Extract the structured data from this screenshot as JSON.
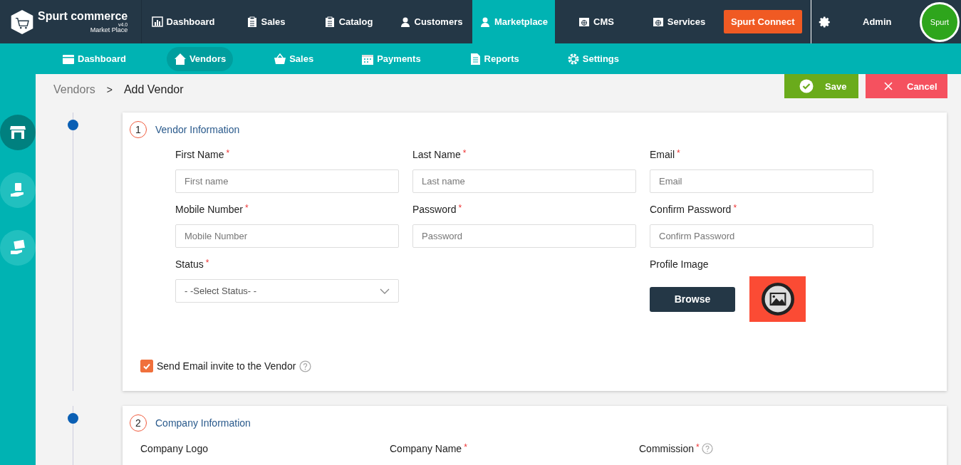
{
  "top_nav": {
    "logo": {
      "name": "Spurt commerce",
      "version": "v4.0",
      "subtitle": "Market Place"
    },
    "items": [
      {
        "label": "Dashboard",
        "selected": false
      },
      {
        "label": "Sales",
        "selected": false
      },
      {
        "label": "Catalog",
        "selected": false
      },
      {
        "label": "Customers",
        "selected": false
      },
      {
        "label": "Marketplace",
        "selected": true
      },
      {
        "label": "CMS",
        "selected": false
      },
      {
        "label": "Services",
        "selected": false
      }
    ],
    "connect_button": "Spurt Connect",
    "user": "Admin",
    "avatar_text": "Spurt"
  },
  "sub_nav": {
    "items": [
      {
        "label": "Dashboard",
        "selected": false
      },
      {
        "label": "Vendors",
        "selected": true
      },
      {
        "label": "Sales",
        "selected": false
      },
      {
        "label": "Payments",
        "selected": false
      },
      {
        "label": "Reports",
        "selected": false
      },
      {
        "label": "Settings",
        "selected": false
      }
    ]
  },
  "side_nav": {
    "items": [
      {
        "selected": true
      },
      {
        "selected": false
      },
      {
        "selected": false
      }
    ]
  },
  "breadcrumb": {
    "parent": "Vendors",
    "separator": ">",
    "current": "Add Vendor"
  },
  "actions": {
    "save": "Save",
    "cancel": "Cancel"
  },
  "sections": [
    {
      "number": "1",
      "title": "Vendor Information",
      "fields": [
        {
          "kind": "text",
          "label": "First Name",
          "required_mark": "*",
          "placeholder": "First name"
        },
        {
          "kind": "text",
          "label": "Last Name",
          "required_mark": "*",
          "placeholder": "Last name"
        },
        {
          "kind": "text",
          "label": "Email",
          "required_mark": "*",
          "placeholder": "Email"
        },
        {
          "kind": "text",
          "label": "Mobile Number",
          "required_mark": "*",
          "placeholder": "Mobile Number"
        },
        {
          "kind": "text",
          "label": "Password",
          "required_mark": "*",
          "placeholder": "Password"
        },
        {
          "kind": "text",
          "label": "Confirm Password",
          "required_mark": "*",
          "placeholder": "Confirm Password"
        },
        {
          "kind": "select",
          "label": "Status",
          "required_mark": "*",
          "value": "- -Select Status- -"
        },
        {
          "kind": "image",
          "label": "Profile Image",
          "button": "Browse"
        }
      ],
      "invite": {
        "label": "Send Email invite to the Vendor",
        "checked": true
      }
    },
    {
      "number": "2",
      "title": "Company Information",
      "fields": [
        {
          "kind": "label",
          "label": "Company Logo"
        },
        {
          "kind": "label",
          "label": "Company Name",
          "required_mark": "*"
        },
        {
          "kind": "label",
          "label": "Commission",
          "required_mark": "*",
          "help": true
        }
      ]
    }
  ]
}
